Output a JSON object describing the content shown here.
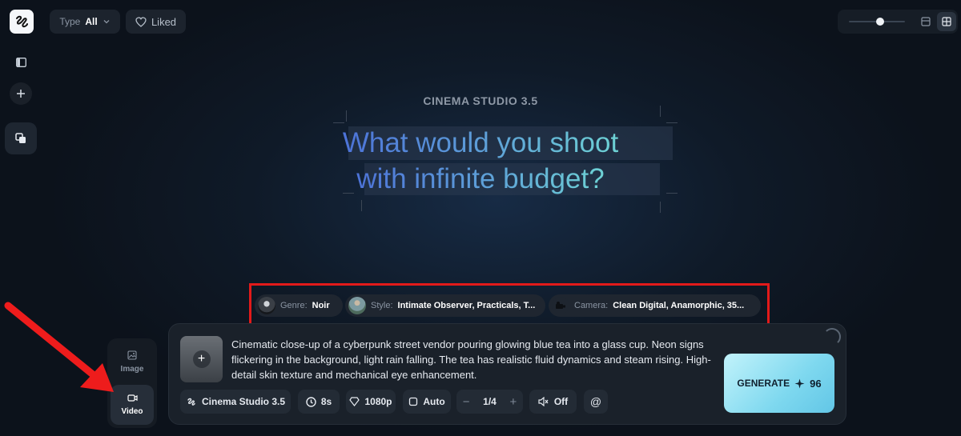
{
  "topbar": {
    "type_filter": {
      "label": "Type",
      "value": "All"
    },
    "liked_label": "Liked",
    "zoom_level": 0.55
  },
  "hero": {
    "eyebrow": "CINEMA STUDIO 3.5",
    "headline_line1": "What would you shoot",
    "headline_line2": "with infinite budget?"
  },
  "chips": [
    {
      "key": "Genre:",
      "value": "Noir"
    },
    {
      "key": "Style:",
      "value": "Intimate Observer, Practicals, T..."
    },
    {
      "key": "Camera:",
      "value": "Clean Digital, Anamorphic, 35..."
    }
  ],
  "mode_switch": {
    "image_label": "Image",
    "video_label": "Video",
    "selected": "Video"
  },
  "composer": {
    "prompt": "Cinematic close-up of a cyberpunk street vendor pouring glowing blue tea into a glass cup. Neon signs flickering in the background, light rain falling. The tea has realistic fluid dynamics and steam rising. High-detail skin texture and mechanical eye enhancement.",
    "generate_label": "GENERATE",
    "generate_cost": "96"
  },
  "toolbar": {
    "model": "Cinema Studio 3.5",
    "duration": "8s",
    "resolution": "1080p",
    "aspect": "Auto",
    "batch_minus": "−",
    "batch_count": "1/4",
    "batch_plus": "+",
    "audio": "Off",
    "mention": "@"
  },
  "colors": {
    "accent_gradient_start": "#4b6fd8",
    "accent_gradient_end": "#6fd6d4",
    "highlight_frame": "#e21a1a",
    "generate_button": "#7ed8ef"
  }
}
